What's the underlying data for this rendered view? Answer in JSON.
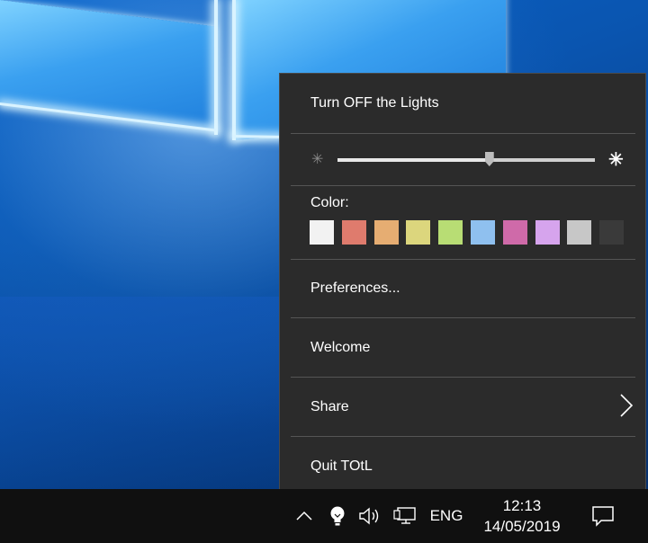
{
  "menu": {
    "turn_off": "Turn OFF the Lights",
    "color_label": "Color:",
    "preferences": "Preferences...",
    "welcome": "Welcome",
    "share": "Share",
    "quit": "Quit TOtL",
    "opacity_slider": {
      "value_fraction": 0.59
    },
    "colors": [
      "#f2f2f2",
      "#df7b6d",
      "#e6ad72",
      "#dcd67d",
      "#b8dd74",
      "#8fc0ef",
      "#cf6aa9",
      "#d6a4ed",
      "#c7c7c7",
      "#3a3a3a"
    ]
  },
  "taskbar": {
    "language": "ENG",
    "time": "12:13",
    "date": "14/05/2019",
    "icons": [
      "chevron-up-icon",
      "lightbulb-icon",
      "speaker-icon",
      "network-icon",
      "notification-icon"
    ]
  }
}
